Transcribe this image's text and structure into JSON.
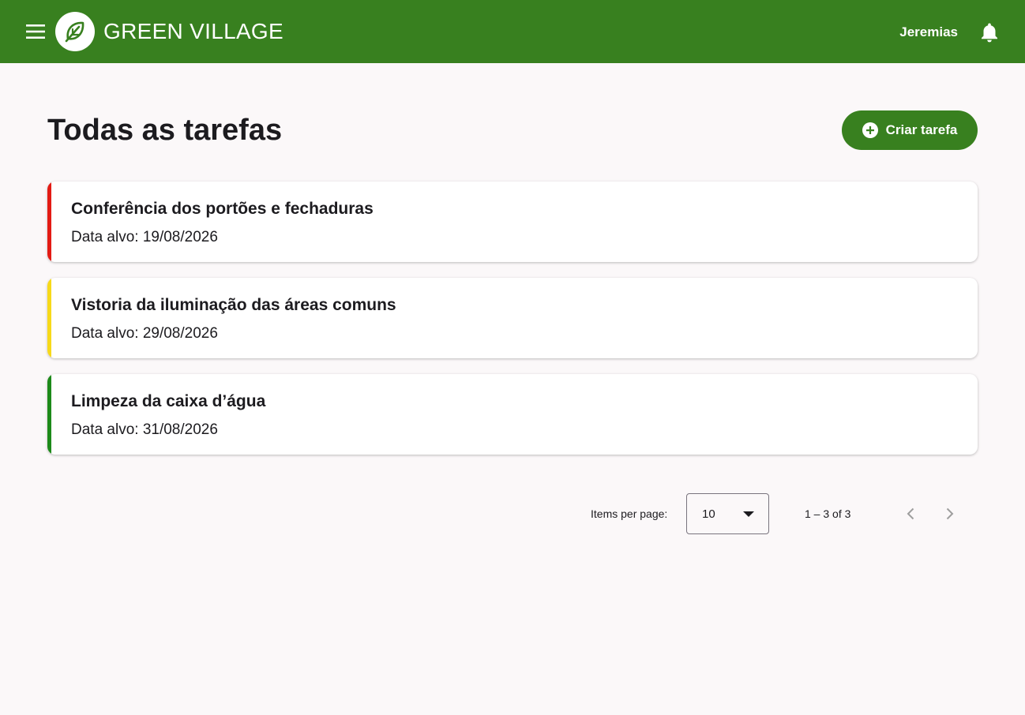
{
  "header": {
    "brand": "GREEN VILLAGE",
    "user_name": "Jeremias",
    "background": "#38801f"
  },
  "main": {
    "title": "Todas as tarefas",
    "create_button_label": "Criar tarefa"
  },
  "tasks": [
    {
      "title": "Conferência dos portões e fechaduras",
      "date": "Data alvo: 19/08/2026",
      "color": "#e31b14"
    },
    {
      "title": "Vistoria da iluminação das áreas comuns",
      "date": "Data alvo: 29/08/2026",
      "color": "#f7d91a"
    },
    {
      "title": "Limpeza da caixa d’água",
      "date": "Data alvo: 31/08/2026",
      "color": "#1d8a1a"
    }
  ],
  "paginator": {
    "items_per_page_label": "Items per page:",
    "page_size": "10",
    "range": "1 – 3 of 3"
  },
  "icons": {
    "menu": "menu-icon",
    "logo": "leaf-logo",
    "bell": "bell-icon",
    "add": "add-circle-icon",
    "prev": "chevron-left-icon",
    "next": "chevron-right-icon"
  }
}
